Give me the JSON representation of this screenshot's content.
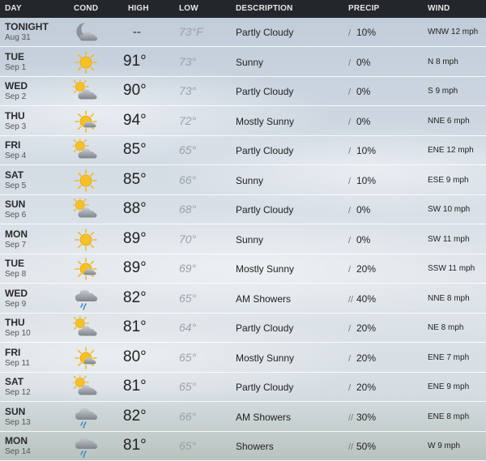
{
  "headers": {
    "day": "DAY",
    "cond": "COND",
    "high": "HIGH",
    "low": "LOW",
    "description": "DESCRIPTION",
    "precip": "PRECIP",
    "wind": "WIND"
  },
  "rows": [
    {
      "day": "TONIGHT",
      "date": "Aug 31",
      "icon": "moon-cloud-icon",
      "high": "--",
      "low": "73°F",
      "description": "Partly Cloudy",
      "precip": "10%",
      "wind": "WNW 12 mph"
    },
    {
      "day": "TUE",
      "date": "Sep 1",
      "icon": "sun-icon",
      "high": "91°",
      "low": "73°",
      "description": "Sunny",
      "precip": "0%",
      "wind": "N 8 mph"
    },
    {
      "day": "WED",
      "date": "Sep 2",
      "icon": "partly-cloudy-icon",
      "high": "90°",
      "low": "73°",
      "description": "Partly Cloudy",
      "precip": "0%",
      "wind": "S 9 mph"
    },
    {
      "day": "THU",
      "date": "Sep 3",
      "icon": "mostly-sunny-icon",
      "high": "94°",
      "low": "72°",
      "description": "Mostly Sunny",
      "precip": "0%",
      "wind": "NNE 6 mph"
    },
    {
      "day": "FRI",
      "date": "Sep 4",
      "icon": "partly-cloudy-icon",
      "high": "85°",
      "low": "65°",
      "description": "Partly Cloudy",
      "precip": "10%",
      "wind": "ENE 12 mph"
    },
    {
      "day": "SAT",
      "date": "Sep 5",
      "icon": "sun-icon",
      "high": "85°",
      "low": "66°",
      "description": "Sunny",
      "precip": "10%",
      "wind": "ESE 9 mph"
    },
    {
      "day": "SUN",
      "date": "Sep 6",
      "icon": "partly-cloudy-icon",
      "high": "88°",
      "low": "68°",
      "description": "Partly Cloudy",
      "precip": "0%",
      "wind": "SW 10 mph"
    },
    {
      "day": "MON",
      "date": "Sep 7",
      "icon": "sun-icon",
      "high": "89°",
      "low": "70°",
      "description": "Sunny",
      "precip": "0%",
      "wind": "SW 11 mph"
    },
    {
      "day": "TUE",
      "date": "Sep 8",
      "icon": "mostly-sunny-icon",
      "high": "89°",
      "low": "69°",
      "description": "Mostly Sunny",
      "precip": "20%",
      "wind": "SSW 11 mph"
    },
    {
      "day": "WED",
      "date": "Sep 9",
      "icon": "showers-icon",
      "high": "82°",
      "low": "65°",
      "description": "AM Showers",
      "precip": "40%",
      "wind": "NNE 8 mph"
    },
    {
      "day": "THU",
      "date": "Sep 10",
      "icon": "partly-cloudy-icon",
      "high": "81°",
      "low": "64°",
      "description": "Partly Cloudy",
      "precip": "20%",
      "wind": "NE 8 mph"
    },
    {
      "day": "FRI",
      "date": "Sep 11",
      "icon": "mostly-sunny-icon",
      "high": "80°",
      "low": "65°",
      "description": "Mostly Sunny",
      "precip": "20%",
      "wind": "ENE 7 mph"
    },
    {
      "day": "SAT",
      "date": "Sep 12",
      "icon": "partly-cloudy-icon",
      "high": "81°",
      "low": "65°",
      "description": "Partly Cloudy",
      "precip": "20%",
      "wind": "ENE 9 mph"
    },
    {
      "day": "SUN",
      "date": "Sep 13",
      "icon": "showers-icon",
      "high": "82°",
      "low": "66°",
      "description": "AM Showers",
      "precip": "30%",
      "wind": "ENE 8 mph"
    },
    {
      "day": "MON",
      "date": "Sep 14",
      "icon": "showers-icon",
      "high": "81°",
      "low": "65°",
      "description": "Showers",
      "precip": "50%",
      "wind": "W 9 mph"
    }
  ],
  "colors": {
    "header_bg": "#23272b",
    "sun": "#f2b71f",
    "cloud": "#8b9097",
    "rain": "#3b83c5"
  }
}
